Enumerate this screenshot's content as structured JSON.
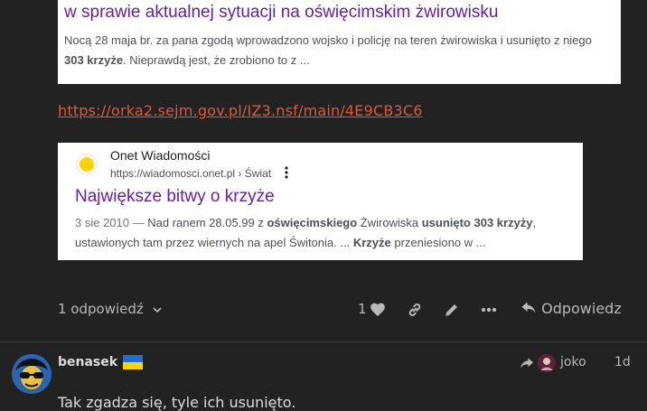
{
  "card1": {
    "title": "w sprawie aktualnej sytuacji na oświęcimskim żwirowisku",
    "snippet_a": "Nocą 28 maja br. za pana zgodą wprowadzono wojsko i policję na teren żwirowiska i usunięto z niego ",
    "snippet_bold": "303 krzyże",
    "snippet_b": ". Nieprawdą jest, że zrobiono to z ..."
  },
  "link": {
    "text": "https://orka2.sejm.gov.pl/IZ3.nsf/main/4E9CB3C6"
  },
  "card2": {
    "site_name": "Onet Wiadomości",
    "site_url": "https://wiadomosci.onet.pl › Świat",
    "title": "Największe bitwy o krzyże",
    "date": "3 sie 2010 — ",
    "s1": "Nad ranem 28.05.99 z ",
    "b1": "oświęcimskiego",
    "s2": " Żwirowiska ",
    "b2": "usunięto 303 krzyży",
    "s3": ", ustawionych tam przez wiernych na apel Świtonia. ... ",
    "b3": "Krzyże",
    "s4": " przeniesiono w ..."
  },
  "post_controls": {
    "replies_label": "1 odpowiedź",
    "like_count": "1",
    "reply_label": "Odpowiedz"
  },
  "next_post": {
    "username": "benasek",
    "reply_to_name": "joko",
    "age": "1d",
    "text": "Tak zgadza się, tyle ich usunięto."
  },
  "colors": {
    "background": "#222222",
    "link": "#e45735",
    "serp_title": "#681da8",
    "muted_text": "#b8b8b8"
  }
}
